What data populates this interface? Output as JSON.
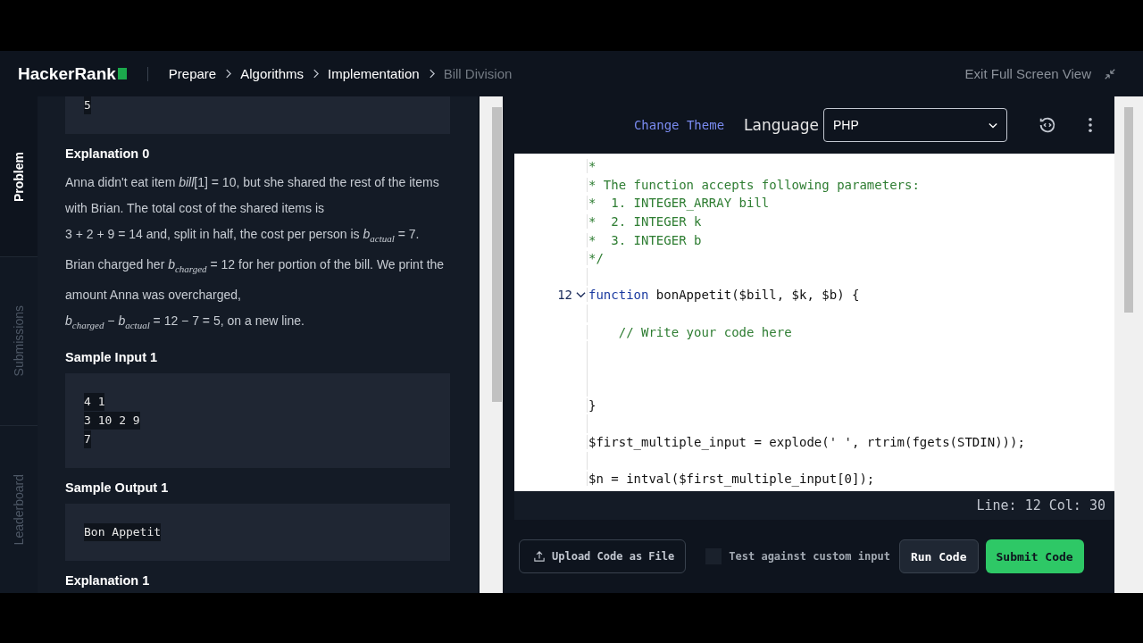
{
  "header": {
    "logo": "HackerRank",
    "breadcrumbs": [
      {
        "label": "Prepare",
        "current": false
      },
      {
        "label": "Algorithms",
        "current": false
      },
      {
        "label": "Implementation",
        "current": false
      },
      {
        "label": "Bill Division",
        "current": true
      }
    ],
    "exit_label": "Exit Full Screen View"
  },
  "sidebar": {
    "tabs": [
      {
        "label": "Problem",
        "selected": true
      },
      {
        "label": "Submissions",
        "selected": false
      },
      {
        "label": "Leaderboard",
        "selected": false
      }
    ]
  },
  "problem": {
    "blocks": [
      {
        "kind": "code",
        "lines": [
          "5"
        ]
      },
      {
        "kind": "heading",
        "text": "Explanation 0"
      },
      {
        "kind": "paragraph",
        "text": "Anna didn't eat item *bill*[1] = 10, but she shared the rest of the items with Brian. The total cost of the shared items is"
      },
      {
        "kind": "paragraph",
        "text": "3 + 2 + 9 = 14 and, split in half, the cost per person is *b*$_{actual}$ = 7. Brian charged her *b*$_{charged}$ = 12 for her portion of the bill. We print the amount Anna was overcharged,"
      },
      {
        "kind": "paragraph",
        "text": "*b*$_{charged}$ − *b*$_{actual}$ = 12 − 7 = 5, on a new line."
      },
      {
        "kind": "heading",
        "text": "Sample Input 1"
      },
      {
        "kind": "code",
        "lines": [
          "4 1",
          "3 10 2 9",
          "7"
        ]
      },
      {
        "kind": "heading",
        "text": "Sample Output 1"
      },
      {
        "kind": "code",
        "lines": [
          "Bon Appetit"
        ]
      },
      {
        "kind": "heading",
        "text": "Explanation 1"
      }
    ]
  },
  "editor": {
    "change_theme": "Change Theme",
    "language_label": "Language",
    "language": "PHP",
    "lines": [
      {
        "parts": [
          {
            "kind": "comment",
            "text": "*"
          }
        ]
      },
      {
        "parts": [
          {
            "kind": "comment",
            "text": "* The function accepts following parameters:"
          }
        ]
      },
      {
        "parts": [
          {
            "kind": "comment",
            "text": "*  1. INTEGER_ARRAY bill"
          }
        ]
      },
      {
        "parts": [
          {
            "kind": "comment",
            "text": "*  2. INTEGER k"
          }
        ]
      },
      {
        "parts": [
          {
            "kind": "comment",
            "text": "*  3. INTEGER b"
          }
        ]
      },
      {
        "parts": [
          {
            "kind": "comment",
            "text": "*/"
          }
        ]
      },
      {
        "kind": "blank"
      },
      {
        "number": "12",
        "fold": true,
        "parts": [
          {
            "kind": "keyword",
            "text": "function"
          },
          {
            "kind": "plain",
            "text": " bonAppetit($bill, $k, $b) {"
          }
        ]
      },
      {
        "kind": "blank"
      },
      {
        "parts": [
          {
            "kind": "comment",
            "text": "    // Write your code here"
          }
        ]
      },
      {
        "kind": "blank"
      },
      {
        "kind": "blank"
      },
      {
        "kind": "blank"
      },
      {
        "parts": [
          {
            "kind": "plain",
            "text": "}"
          }
        ]
      },
      {
        "kind": "blank"
      },
      {
        "parts": [
          {
            "kind": "plain",
            "text": "$first_multiple_input = explode(' ', rtrim(fgets(STDIN)));"
          }
        ]
      },
      {
        "kind": "blank"
      },
      {
        "parts": [
          {
            "kind": "plain",
            "text": "$n = intval($first_multiple_input[0]);"
          }
        ]
      }
    ],
    "status": "Line: 12 Col: 30"
  },
  "footer": {
    "upload": "Upload Code as File",
    "custom_input": {
      "label": "Test against custom input",
      "checked": false
    },
    "run": "Run Code",
    "submit": "Submit Code"
  }
}
